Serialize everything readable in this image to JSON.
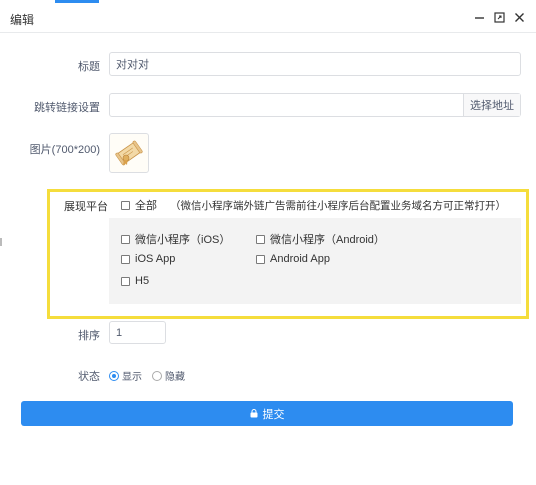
{
  "dialog": {
    "title": "编辑",
    "controls": {
      "minimize": "—",
      "maximize": "⤢",
      "close": "✕"
    }
  },
  "form": {
    "title_label": "标题",
    "title_value": "对对对",
    "link_label": "跳转链接设置",
    "link_value": "",
    "link_button": "选择地址",
    "image_label": "图片(700*200)",
    "platform_label": "展现平台",
    "select_all": "全部",
    "select_all_hint": "（微信小程序端外链广告需前往小程序后台配置业务域名方可正常打开）",
    "platforms": [
      {
        "label": "微信小程序（iOS）",
        "checked": false
      },
      {
        "label": "微信小程序（Android）",
        "checked": false
      },
      {
        "label": "iOS App",
        "checked": false
      },
      {
        "label": "Android App",
        "checked": false
      },
      {
        "label": "H5",
        "checked": false
      }
    ],
    "sort_label": "排序",
    "sort_value": "1",
    "status_label": "状态",
    "status_options": [
      {
        "label": "显示",
        "checked": true
      },
      {
        "label": "隐藏",
        "checked": false
      }
    ],
    "submit_label": "提交"
  },
  "colors": {
    "primary": "#2d8cf0",
    "highlight": "#f5dd3c"
  }
}
